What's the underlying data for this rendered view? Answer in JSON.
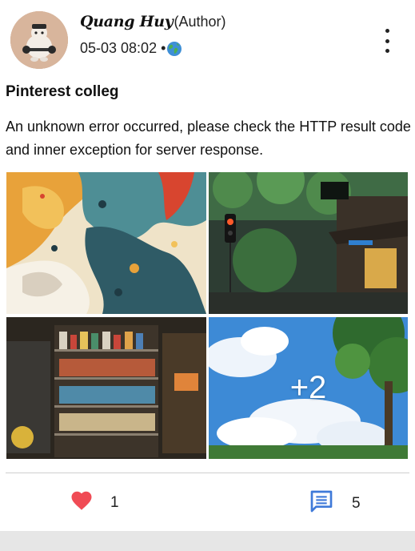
{
  "post": {
    "author_name": "Quang Huy",
    "author_tag": "(Author)",
    "timestamp": "05-03 08:02",
    "separator": "•",
    "visibility_icon": "globe-icon",
    "title": "Pinterest colleg",
    "body": "An unknown error occurred, please check the HTTP result code and inner exception for server response.",
    "extra_images": "+2"
  },
  "actions": {
    "like_icon": "heart-icon",
    "like_count": "1",
    "comment_icon": "comment-icon",
    "comment_count": "5"
  },
  "colors": {
    "heart": "#f04b55",
    "comment": "#3f7ad9"
  }
}
